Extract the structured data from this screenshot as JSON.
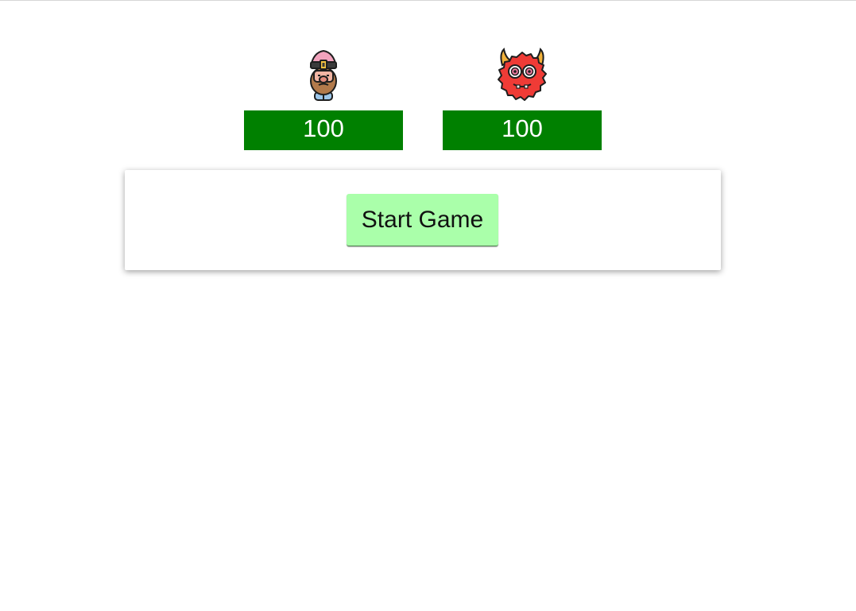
{
  "player": {
    "icon": "gnome-player-icon",
    "health": 100,
    "health_label": "100",
    "health_color": "#008000"
  },
  "monster": {
    "icon": "red-monster-icon",
    "health": 100,
    "health_label": "100",
    "health_color": "#008000"
  },
  "controls": {
    "start_label": "Start Game",
    "start_color": "#aaffaa"
  }
}
